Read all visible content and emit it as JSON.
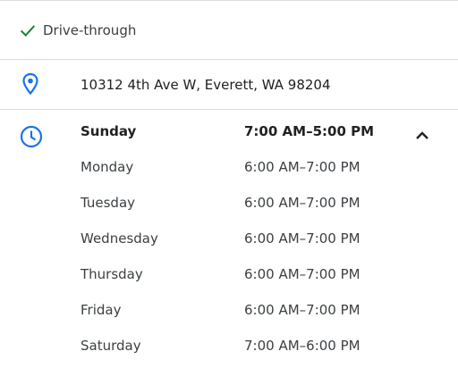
{
  "colors": {
    "accent_blue": "#1a73e8",
    "check_green": "#188038",
    "divider": "#dadce0",
    "text_primary": "#202124",
    "text_secondary": "#3c4043"
  },
  "feature": {
    "icon": "check-icon",
    "label": "Drive-through"
  },
  "address": {
    "icon": "location-pin-icon",
    "text": "10312 4th Ave W, Everett, WA 98204"
  },
  "hours": {
    "icon": "clock-icon",
    "toggle_icon": "chevron-up-icon",
    "days": [
      {
        "day": "Sunday",
        "time": "7:00 AM–5:00 PM"
      },
      {
        "day": "Monday",
        "time": "6:00 AM–7:00 PM"
      },
      {
        "day": "Tuesday",
        "time": "6:00 AM–7:00 PM"
      },
      {
        "day": "Wednesday",
        "time": "6:00 AM–7:00 PM"
      },
      {
        "day": "Thursday",
        "time": "6:00 AM–7:00 PM"
      },
      {
        "day": "Friday",
        "time": "6:00 AM–7:00 PM"
      },
      {
        "day": "Saturday",
        "time": "7:00 AM–6:00 PM"
      }
    ]
  }
}
